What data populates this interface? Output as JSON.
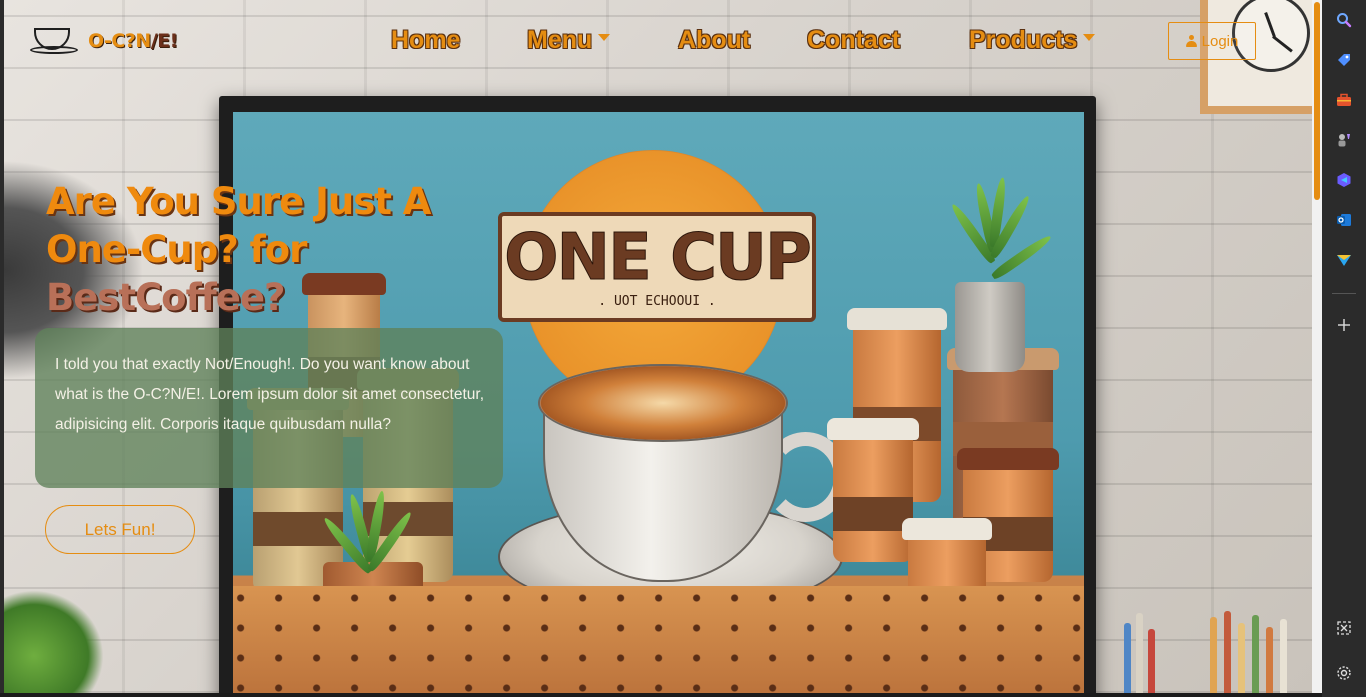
{
  "brand": {
    "logo_text_a": "O-C?N",
    "logo_text_b": "/E!"
  },
  "nav": {
    "items": [
      {
        "label": "Home",
        "has_caret": false
      },
      {
        "label": "Menu",
        "has_caret": true
      },
      {
        "label": "About",
        "has_caret": false
      },
      {
        "label": "Contact",
        "has_caret": false
      },
      {
        "label": "Products",
        "has_caret": true
      }
    ],
    "login_label": "Login"
  },
  "hero": {
    "title_line1": "Are You Sure Just A",
    "title_line2": "One-Cup? for",
    "title_line3": "BestCoffee?",
    "description": "I told you that exactly Not/Enough!. Do you want know about what is the O-C?N/E!. Lorem ipsum dolor sit amet consectetur, adipisicing elit. Corporis itaque quibusdam nulla?",
    "cta_label": "Lets Fun!"
  },
  "poster": {
    "sign_title": "ONE CUP",
    "sign_subtitle": ". UOT ECHOOUI ."
  },
  "sidebar": {
    "icons": [
      "search-icon",
      "tag-icon",
      "toolbox-icon",
      "games-icon",
      "copilot-icon",
      "outlook-icon",
      "send-icon",
      "add-icon",
      "screenshot-icon",
      "settings-icon"
    ]
  },
  "colors": {
    "accent": "#e58d12",
    "card": "#5f825a",
    "title_brown": "#b87058"
  }
}
